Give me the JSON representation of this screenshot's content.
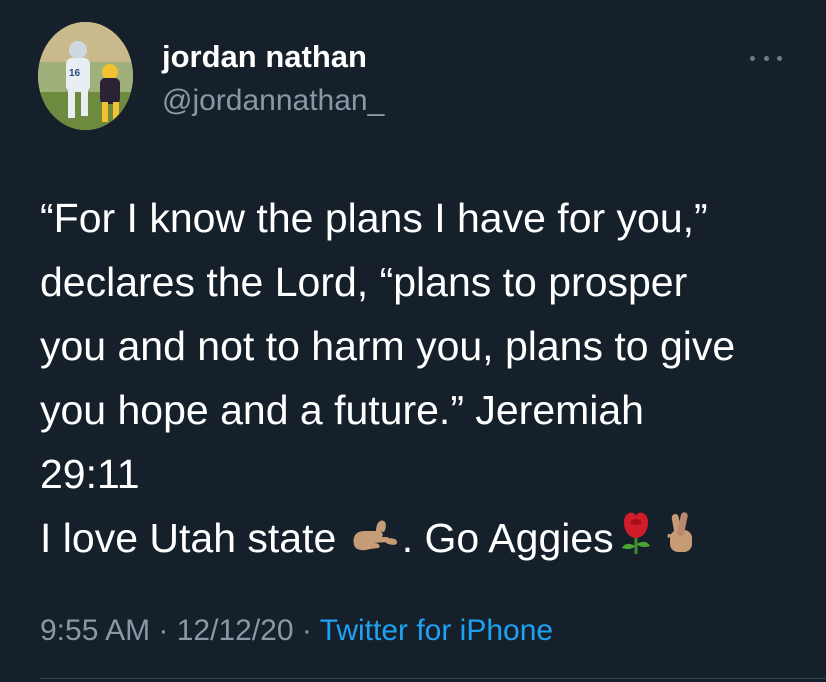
{
  "user": {
    "display_name": "jordan nathan",
    "handle": "@jordannathan_"
  },
  "tweet": {
    "lines": [
      "“For I know the plans I have for you,”",
      "declares the Lord, “plans to prosper",
      "you and not to harm you, plans to give",
      "you hope and a future.” Jeremiah",
      "29:11"
    ],
    "last_line_part1": "I love Utah state",
    "last_line_part2": ". Go Aggies",
    "emojis": [
      "call-me-hand-emoji",
      "rose-emoji",
      "crossed-fingers-emoji"
    ]
  },
  "meta": {
    "time": "9:55 AM",
    "separator": " · ",
    "date": "12/12/20",
    "source": "Twitter for iPhone"
  },
  "colors": {
    "background": "#15202b",
    "text": "#ffffff",
    "secondary": "#8899a6",
    "link": "#1da1f2"
  }
}
